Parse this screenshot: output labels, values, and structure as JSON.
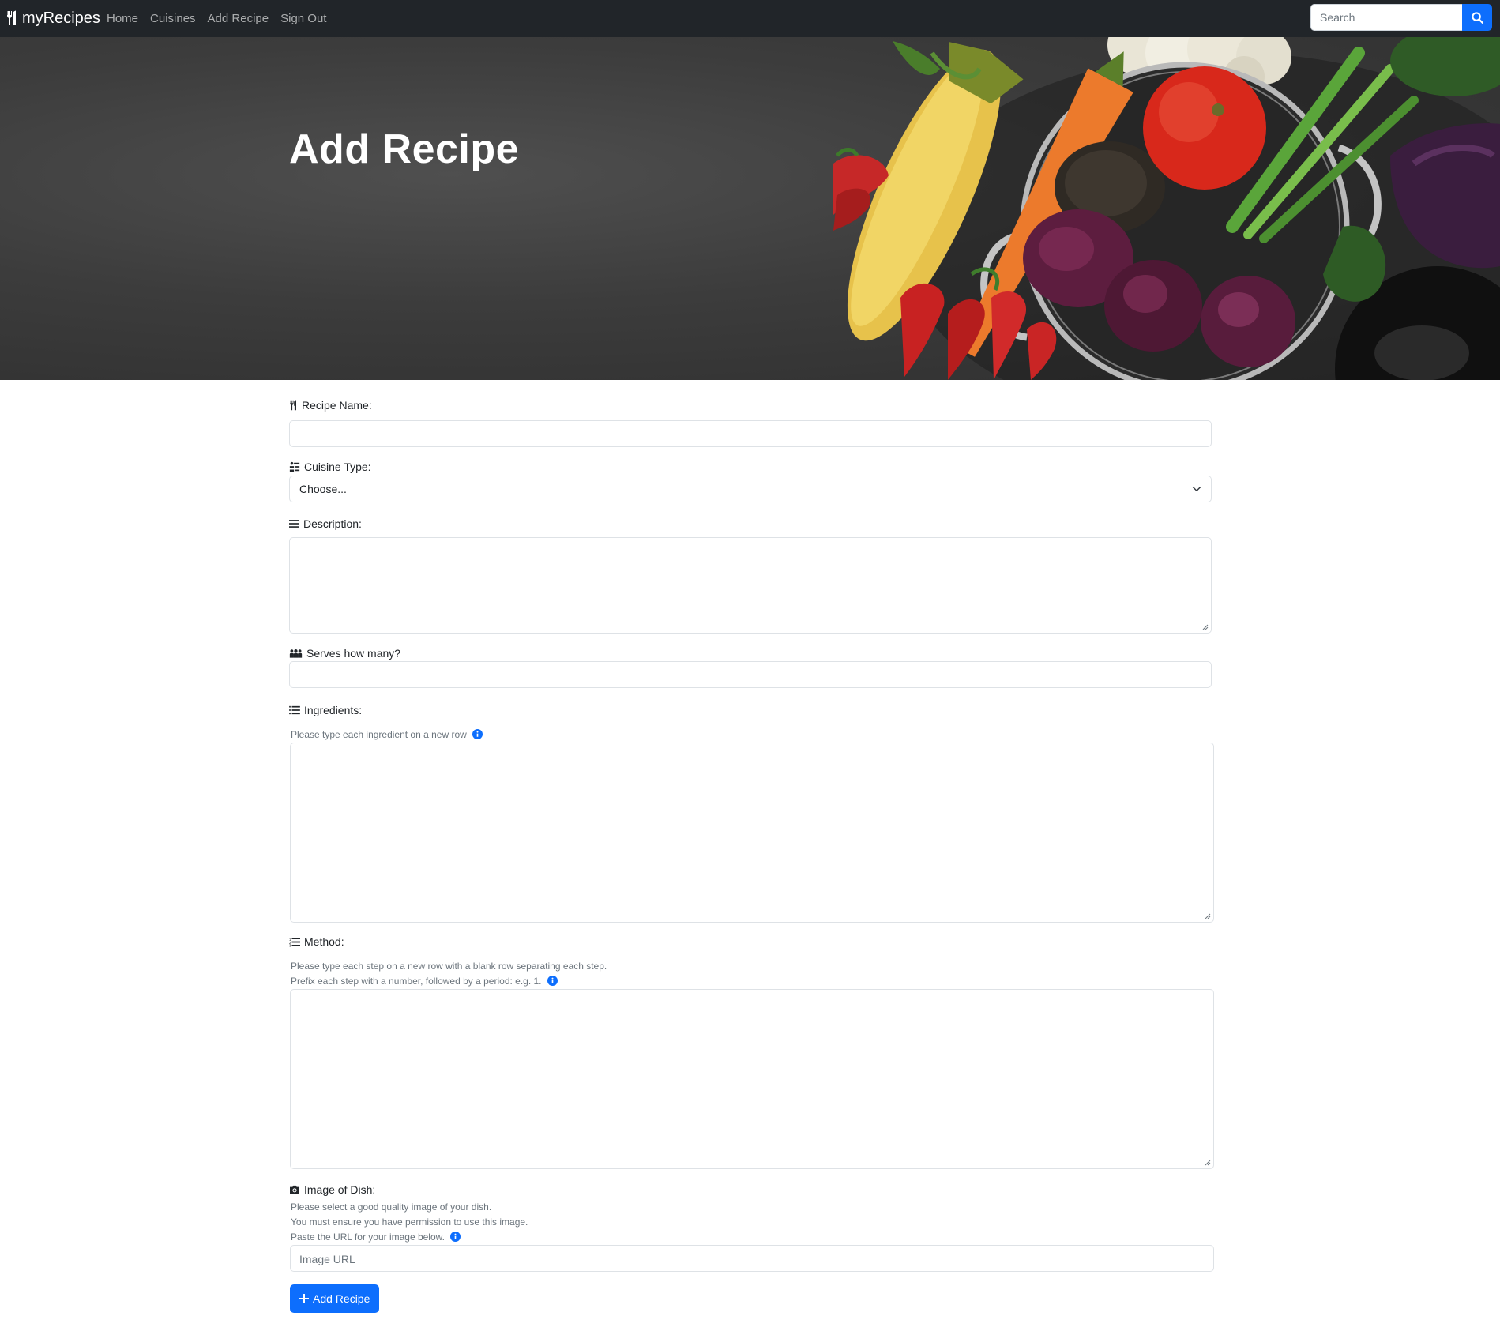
{
  "nav": {
    "brand": "myRecipes",
    "links": [
      "Home",
      "Cuisines",
      "Add Recipe",
      "Sign Out"
    ],
    "search_placeholder": "Search"
  },
  "hero": {
    "title": "Add Recipe"
  },
  "form": {
    "recipe_name_label": "Recipe Name:",
    "cuisine_label": "Cuisine Type:",
    "cuisine_selected": "Choose...",
    "description_label": "Description:",
    "serves_label": "Serves how many?",
    "ingredients_label": "Ingredients:",
    "ingredients_hint": "Please type each ingredient on a new row",
    "method_label": "Method:",
    "method_hint_1": "Please type each step on a new row with a blank row separating each step.",
    "method_hint_2": "Prefix each step with a number, followed by a period: e.g. 1.",
    "image_label": "Image of Dish:",
    "image_hint_1": "Please select a good quality image of your dish.",
    "image_hint_2": "You must ensure you have permission to use this image.",
    "image_hint_3": "Paste the URL for your image below.",
    "image_placeholder": "Image URL",
    "submit_label": "Add Recipe"
  },
  "colors": {
    "navbar": "#212529",
    "primary": "#0d6efd",
    "info": "#0d6efd"
  }
}
